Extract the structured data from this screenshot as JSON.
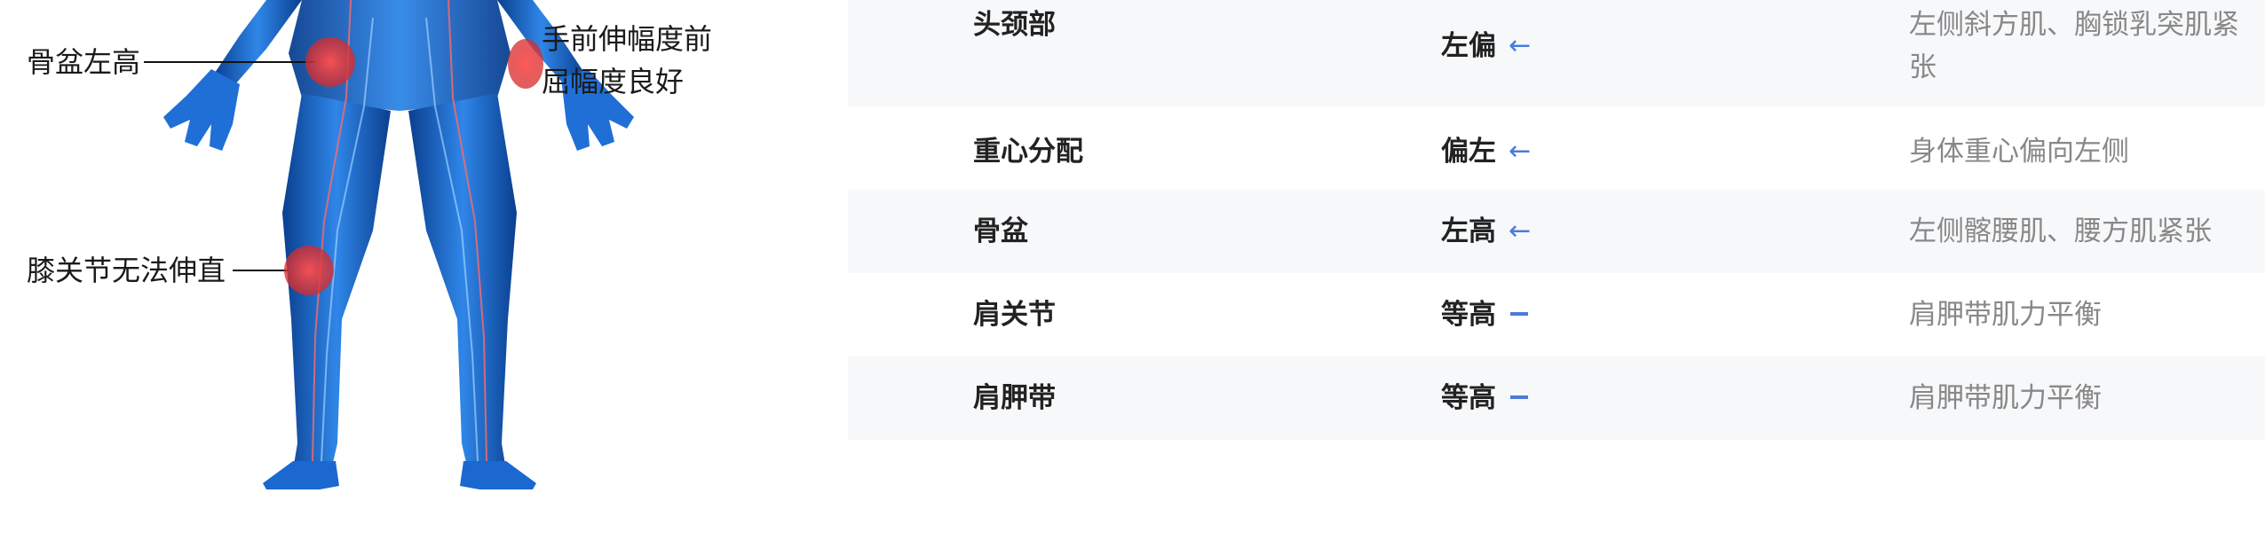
{
  "figure": {
    "callouts": {
      "pelvis": "骨盆左高",
      "arm": "手前伸幅度前屈幅度良好",
      "knee": "膝关节无法伸直"
    },
    "colors": {
      "body": "#1560c8",
      "marker": "#e63a3a"
    }
  },
  "table": {
    "rows": [
      {
        "part": "头颈部",
        "status": "左偏",
        "trend": "arrow-left-icon",
        "note": "左侧斜方肌、胸锁乳突肌紧张"
      },
      {
        "part": "重心分配",
        "status": "偏左",
        "trend": "arrow-left-icon",
        "note": "身体重心偏向左侧"
      },
      {
        "part": "骨盆",
        "status": "左高",
        "trend": "arrow-left-icon",
        "note": "左侧髂腰肌、腰方肌紧张"
      },
      {
        "part": "肩关节",
        "status": "等高",
        "trend": "dash-icon",
        "note": "肩胛带肌力平衡"
      },
      {
        "part": "肩胛带",
        "status": "等高",
        "trend": "dash-icon",
        "note": "肩胛带肌力平衡"
      }
    ],
    "colors": {
      "accent": "#4a7bd9",
      "row_shade": "#f7f8fa",
      "note_text": "#888888"
    }
  }
}
